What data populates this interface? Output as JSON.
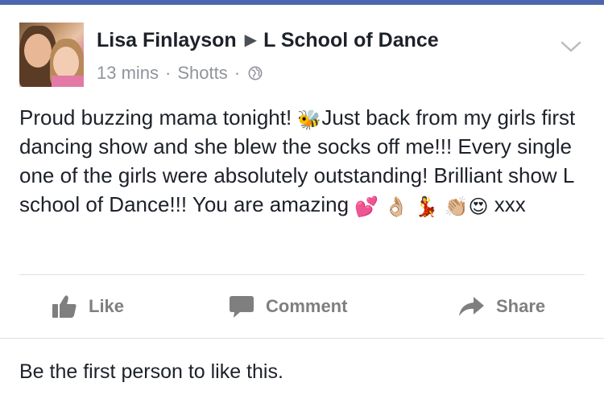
{
  "post": {
    "author": "Lisa Finlayson",
    "target": "L School of Dance",
    "time": "13 mins",
    "separator": "·",
    "location": "Shotts",
    "privacy_icon": "globe-icon",
    "body": {
      "part1": "Proud buzzing mama tonight! ",
      "emoji_bee": "🐝",
      "part2": "Just back from my girls first dancing show and she blew the socks off me!!! Every single one of the girls were absolutely outstanding! Brilliant show L school of Dance!!! You are amazing ",
      "emojis": [
        "💕",
        "👌🏼",
        "💃",
        "👏🏼",
        "😍"
      ],
      "part3": " xxx"
    }
  },
  "actions": {
    "like_label": "Like",
    "comment_label": "Comment",
    "share_label": "Share"
  },
  "likes_text": "Be the first person to like this.",
  "colors": {
    "top_bar": "#4a67ad",
    "text": "#1d2129",
    "meta": "#90949c",
    "action": "#7f7f7f",
    "divider": "#dddfe2"
  }
}
